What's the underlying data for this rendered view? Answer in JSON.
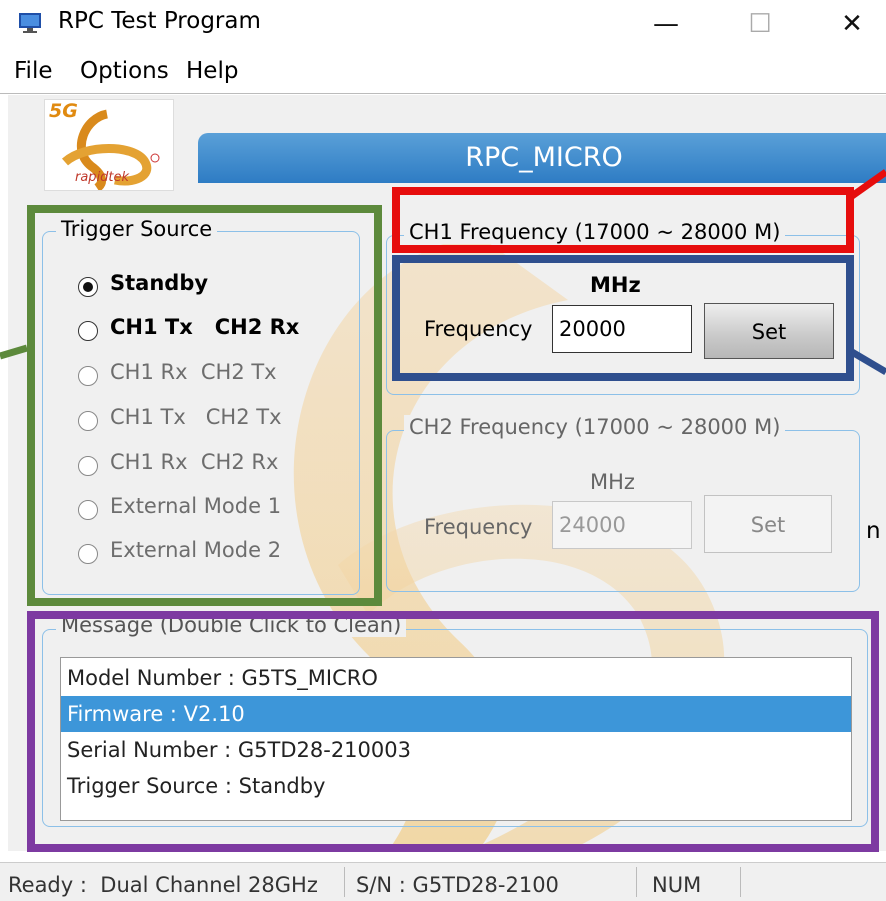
{
  "window": {
    "title": "RPC Test Program",
    "minimize": "—",
    "maximize": "☐",
    "close": "✕"
  },
  "menu": [
    "File",
    "Options",
    "Help"
  ],
  "logo": {
    "badge": "5G",
    "brand": "rapidtek"
  },
  "banner": "RPC_MICRO",
  "trigger": {
    "label": "Trigger Source",
    "options": [
      {
        "text": "Standby",
        "checked": true,
        "enabled": true
      },
      {
        "text": "CH1 Tx   CH2 Rx",
        "checked": false,
        "enabled": true
      },
      {
        "text": "CH1 Rx  CH2 Tx",
        "checked": false,
        "enabled": false
      },
      {
        "text": "CH1 Tx   CH2 Tx",
        "checked": false,
        "enabled": false
      },
      {
        "text": "CH1 Rx  CH2 Rx",
        "checked": false,
        "enabled": false
      },
      {
        "text": "External Mode 1",
        "checked": false,
        "enabled": false
      },
      {
        "text": "External Mode 2",
        "checked": false,
        "enabled": false
      }
    ]
  },
  "ch1": {
    "label": "CH1  Frequency (17000 ~ 28000 M)",
    "unit": "MHz",
    "freq_label": "Frequency",
    "value": "20000",
    "button": "Set"
  },
  "ch2": {
    "label": "CH2  Frequency (17000 ~ 28000 M)",
    "unit": "MHz",
    "freq_label": "Frequency",
    "value": "24000",
    "button": "Set"
  },
  "message": {
    "label": "Message (Double Click to Clean)",
    "lines": [
      "Model Number : G5TS_MICRO",
      "Firmware : V2.10",
      "Serial Number : G5TD28-210003",
      "Trigger Source : Standby"
    ],
    "selected_index": 1
  },
  "stray_text": "n",
  "status": {
    "ready": "Ready :  Dual Channel 28GHz",
    "sn": "S/N : G5TD28-2100",
    "num": "NUM"
  },
  "colors": {
    "banner": "#3a8ad0",
    "selection": "#3d96d9",
    "annotation_green": "#5d8a3c",
    "annotation_red": "#e60d0d",
    "annotation_blue": "#2f4f8e",
    "annotation_purple": "#7d3aa1"
  }
}
